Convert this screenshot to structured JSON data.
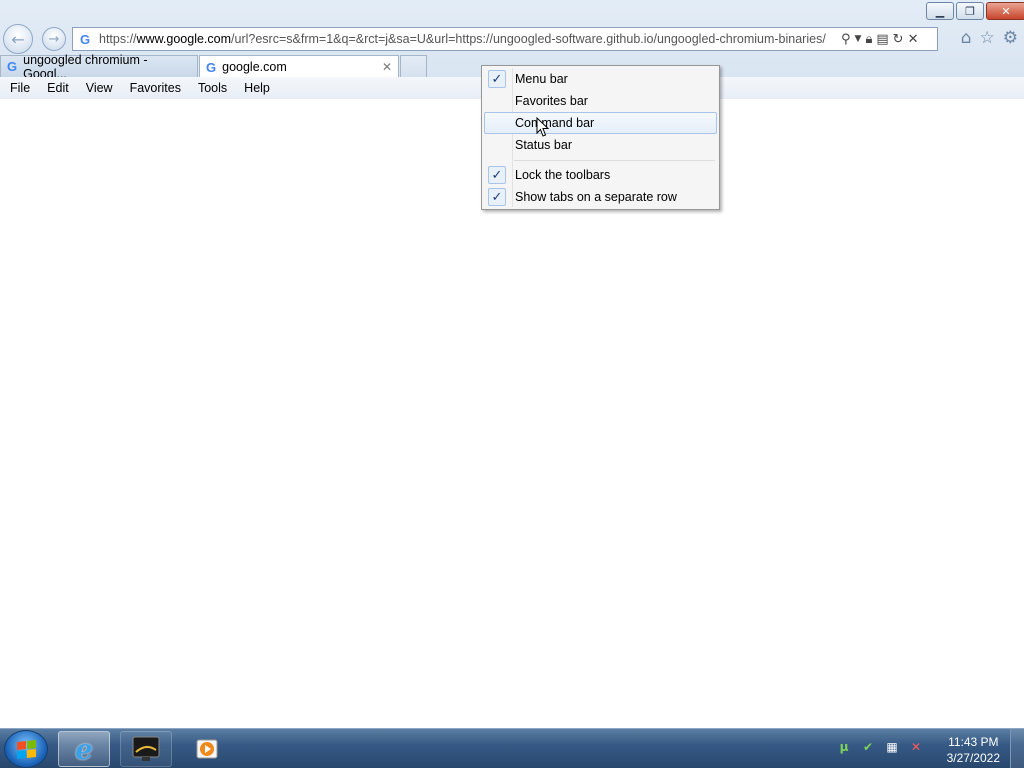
{
  "window": {
    "minimize_label": "▭",
    "restore_label": "❐",
    "close_label": "✕"
  },
  "address_bar": {
    "favicon": "G",
    "url_prefix": "https://",
    "url_domain": "www.google.com",
    "url_rest": "/url?esrc=s&frm=1&q=&rct=j&sa=U&url=https://ungoogled-software.github.io/ungoogled-chromium-binaries/",
    "icons": [
      "search-icon",
      "dropdown-icon",
      "lock-icon",
      "compat-view-icon",
      "refresh-icon",
      "stop-icon"
    ]
  },
  "tabs": [
    {
      "label": "ungoogled chromium - Googl...",
      "favicon": "G",
      "active": false
    },
    {
      "label": "google.com",
      "favicon": "G",
      "active": true
    }
  ],
  "menubar": [
    "File",
    "Edit",
    "View",
    "Favorites",
    "Tools",
    "Help"
  ],
  "context_menu": {
    "items": [
      {
        "label": "Menu bar",
        "checked": true
      },
      {
        "label": "Favorites bar",
        "checked": false
      },
      {
        "label": "Command bar",
        "checked": false,
        "hover": true
      },
      {
        "label": "Status bar",
        "checked": false
      }
    ],
    "items2": [
      {
        "label": "Lock the toolbars",
        "checked": true
      },
      {
        "label": "Show tabs on a separate row",
        "checked": true
      }
    ]
  },
  "taskbar": {
    "clock_time": "11:43 PM",
    "clock_date": "3/27/2022"
  }
}
